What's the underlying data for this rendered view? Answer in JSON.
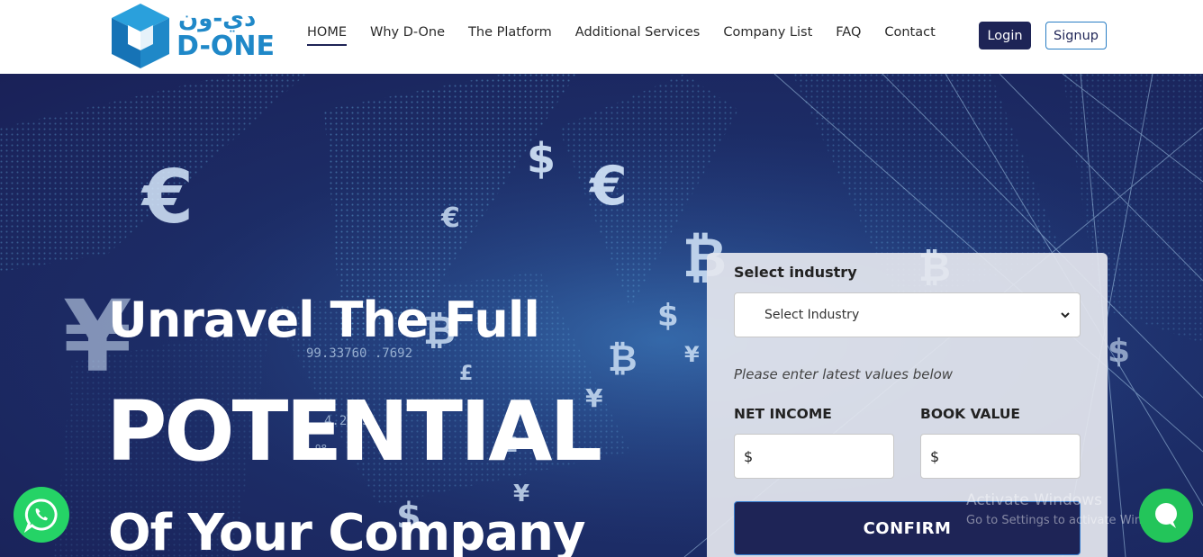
{
  "brand": {
    "arabic": "دي-ون",
    "latin": "D-ONE",
    "colors": {
      "primary": "#1e2456",
      "accent": "#1f88c8",
      "whatsapp": "#25d366"
    },
    "logo_icon": "cube-logo-icon"
  },
  "nav": {
    "items": [
      {
        "label": "HOME",
        "active": true
      },
      {
        "label": "Why D-One",
        "active": false
      },
      {
        "label": "The Platform",
        "active": false
      },
      {
        "label": "Additional Services",
        "active": false
      },
      {
        "label": "Company List",
        "active": false
      },
      {
        "label": "FAQ",
        "active": false
      },
      {
        "label": "Contact",
        "active": false
      }
    ],
    "login_label": "Login",
    "signup_label": "Signup"
  },
  "hero": {
    "line1": "Unravel The Full",
    "line2": "POTENTIAL",
    "line3": "Of Your Company"
  },
  "form": {
    "industry_label": "Select industry",
    "industry_selected": "Select Industry",
    "hint": "Please enter latest values below",
    "net_income_label": "NET INCOME",
    "net_income_prefix": "$",
    "net_income_value": "",
    "book_value_label": "BOOK VALUE",
    "book_value_prefix": "$",
    "book_value_value": "",
    "confirm_label": "CONFIRM"
  },
  "watermark": {
    "line1": "Activate Windows",
    "line2": "Go to Settings to activate Windows."
  },
  "floating": {
    "whatsapp_icon": "whatsapp-icon",
    "chat_icon": "chat-bubble-icon"
  }
}
